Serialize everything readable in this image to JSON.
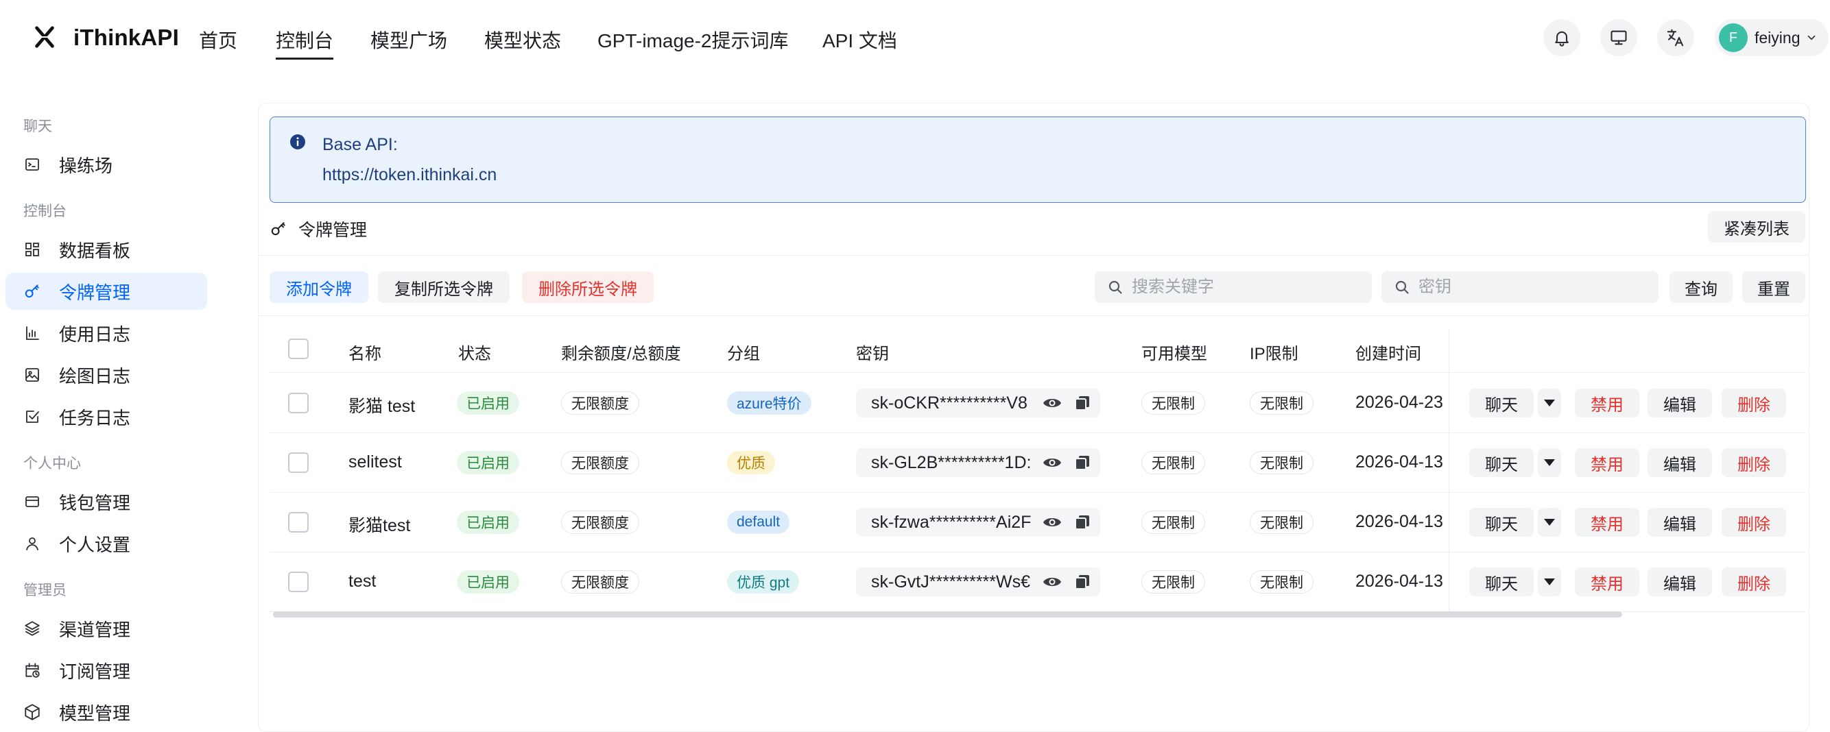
{
  "header": {
    "brand": "iThinkAPI",
    "nav": [
      "首页",
      "控制台",
      "模型广场",
      "模型状态",
      "GPT-image-2提示词库",
      "API 文档"
    ],
    "active_nav": "控制台",
    "user": {
      "initial": "F",
      "name": "feiying",
      "avatar_color": "#3bbfa6"
    },
    "icons": [
      "bell-icon",
      "monitor-icon",
      "translate-icon",
      "chevron-down-icon"
    ]
  },
  "sidebar": {
    "groups": [
      {
        "label": "聊天",
        "items": [
          {
            "label": "操练场",
            "icon": "terminal-icon"
          }
        ]
      },
      {
        "label": "控制台",
        "items": [
          {
            "label": "数据看板",
            "icon": "dashboard-icon"
          },
          {
            "label": "令牌管理",
            "icon": "key-icon",
            "active": true
          },
          {
            "label": "使用日志",
            "icon": "bar-chart-icon"
          },
          {
            "label": "绘图日志",
            "icon": "image-icon"
          },
          {
            "label": "任务日志",
            "icon": "task-check-icon"
          }
        ]
      },
      {
        "label": "个人中心",
        "items": [
          {
            "label": "钱包管理",
            "icon": "wallet-icon"
          },
          {
            "label": "个人设置",
            "icon": "user-icon"
          }
        ]
      },
      {
        "label": "管理员",
        "items": [
          {
            "label": "渠道管理",
            "icon": "layers-icon"
          },
          {
            "label": "订阅管理",
            "icon": "calendar-clock-icon"
          },
          {
            "label": "模型管理",
            "icon": "cube-icon"
          }
        ]
      }
    ]
  },
  "alert": {
    "title": "Base API:",
    "url": "https://token.ithinkai.cn"
  },
  "section": {
    "title": "令牌管理",
    "compact_label": "紧凑列表"
  },
  "toolbar": {
    "add_label": "添加令牌",
    "copy_label": "复制所选令牌",
    "delete_label": "删除所选令牌",
    "search_placeholder": "搜索关键字",
    "key_placeholder": "密钥",
    "query_label": "查询",
    "reset_label": "重置"
  },
  "table": {
    "columns": [
      "名称",
      "状态",
      "剩余额度/总额度",
      "分组",
      "密钥",
      "可用模型",
      "IP限制",
      "创建时间"
    ],
    "rows": [
      {
        "name": "影猫 test",
        "status": "已启用",
        "quota": "无限额度",
        "group": "azure特价",
        "group_color": "blue",
        "key": "sk-oCKR**********V8",
        "models": "无限制",
        "ip": "无限制",
        "created": "2026-04-23"
      },
      {
        "name": "selitest",
        "status": "已启用",
        "quota": "无限额度",
        "group": "优质",
        "group_color": "yellow",
        "key": "sk-GL2B**********1D:",
        "models": "无限制",
        "ip": "无限制",
        "created": "2026-04-13"
      },
      {
        "name": "影猫test",
        "status": "已启用",
        "quota": "无限额度",
        "group": "default",
        "group_color": "blue",
        "key": "sk-fzwa**********Ai2F",
        "models": "无限制",
        "ip": "无限制",
        "created": "2026-04-13"
      },
      {
        "name": "test",
        "status": "已启用",
        "quota": "无限额度",
        "group": "优质 gpt",
        "group_color": "cyan",
        "key": "sk-GvtJ**********Ws€",
        "models": "无限制",
        "ip": "无限制",
        "created": "2026-04-13"
      }
    ],
    "row_actions": [
      "聊天",
      "禁用",
      "编辑",
      "删除"
    ]
  }
}
